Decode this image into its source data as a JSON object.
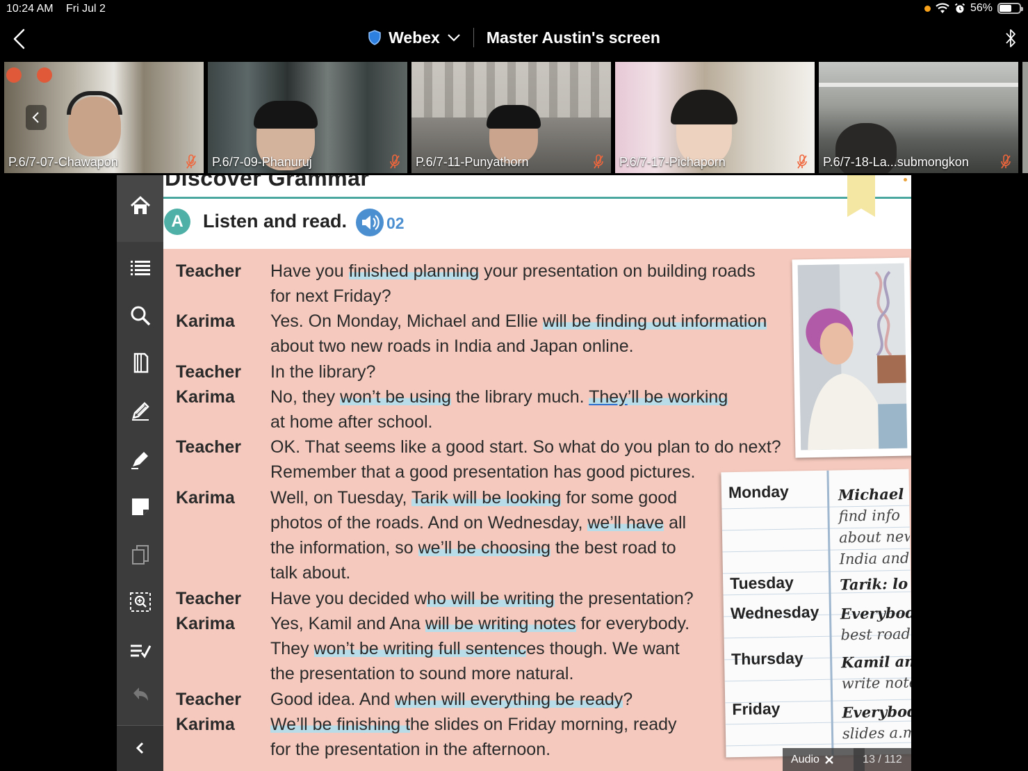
{
  "status_bar": {
    "time": "10:24 AM",
    "date": "Fri Jul 2",
    "battery": "56%"
  },
  "title_bar": {
    "app": "Webex",
    "title": "Master Austin's screen"
  },
  "participants": [
    {
      "name": "P.6/7-07-Chawapon"
    },
    {
      "name": "P.6/7-09-Phanuruj"
    },
    {
      "name": "P.6/7-11-Punyathorn"
    },
    {
      "name": "P.6/7-17-Pichaporn"
    },
    {
      "name": "P.6/7-18-La...submongkon"
    }
  ],
  "lesson": {
    "heading": "Discover Grammar",
    "badge": "A",
    "instruction": "Listen and read.",
    "track": "02",
    "dialog": [
      {
        "speaker": "Teacher",
        "line1": [
          "Have you ",
          {
            "h": "finished planning"
          },
          " your presentation on building roads"
        ],
        "line2": "for next Friday?"
      },
      {
        "speaker": "Karima"
      }
    ],
    "speakers": {
      "s1": "Teacher",
      "s2": "Karima",
      "s3": "Teacher",
      "s4": "Karima",
      "s5": "Teacher",
      "s6": "Karima",
      "s7": "Teacher",
      "s8": "Karima",
      "s9": "Teacher",
      "s10": "Karima"
    },
    "text": {
      "l1a": "Have you ",
      "l1b": "finished planning",
      "l1c": " your presentation on building roads",
      "l2": "for next Friday?",
      "l3a": "Yes. On Monday, Michael and Ellie ",
      "l3b": "will be finding out information",
      "l4": "about two new roads in India and Japan online.",
      "l5": "In the library?",
      "l6a": "No, they ",
      "l6b": "won’t be using",
      "l6c": " the library much. ",
      "l6d": "They",
      "l6e": "’ll be working",
      "l7": "at home after school.",
      "l8": "OK. That seems like a good start. So what do you plan to do next?",
      "l9": "Remember that a good presentation has good pictures.",
      "l10a": "Well, on Tuesday, ",
      "l10b": "Tarik will be looking",
      "l10c": " for some good",
      "l11a": "photos of the roads. And on Wednesday, ",
      "l11b": "we’ll have",
      "l11c": " all",
      "l12a": "the information, so ",
      "l12b": "we’ll be choosing",
      "l12c": " the best road to",
      "l13": "talk about.",
      "l14a": "Have you decided w",
      "l14b": "ho will be writing",
      "l14c": " the presentation?",
      "l15a": "Yes, Kamil and Ana ",
      "l15b": "will be writing notes",
      "l15c": " for everybody.",
      "l16a": "They ",
      "l16b": "won’t be writing full sentenc",
      "l16c": "es though. We want",
      "l17": "the presentation to sound more natural.",
      "l18a": "Good idea. And ",
      "l18b": "when will everything be ready",
      "l18c": "?",
      "l19a": "We’ll be finishing t",
      "l19b": "he slides on Friday morning, ready",
      "l20": "for the presentation in the afternoon."
    },
    "notepad": {
      "days": {
        "mon": "Monday",
        "tue": "Tuesday",
        "wed": "Wednesday",
        "thu": "Thursday",
        "fri": "Friday"
      },
      "notes": {
        "n1": "Michael",
        "n2": "find info",
        "n3": "about new",
        "n4": "India and",
        "n5": "Tarik: lo",
        "n6": "Everybod",
        "n7": "best road",
        "n8": "Kamil an",
        "n9": "write note",
        "n10": "Everybod",
        "n11": "slides a.m"
      }
    },
    "audio_label": "Audio",
    "page_indicator": "13 / 112"
  },
  "colors": {
    "teal": "#4aa7a0",
    "pink_panel": "#f5c9bd",
    "highlight": "#b9dde8",
    "audio_blue": "#4b8fd0"
  }
}
